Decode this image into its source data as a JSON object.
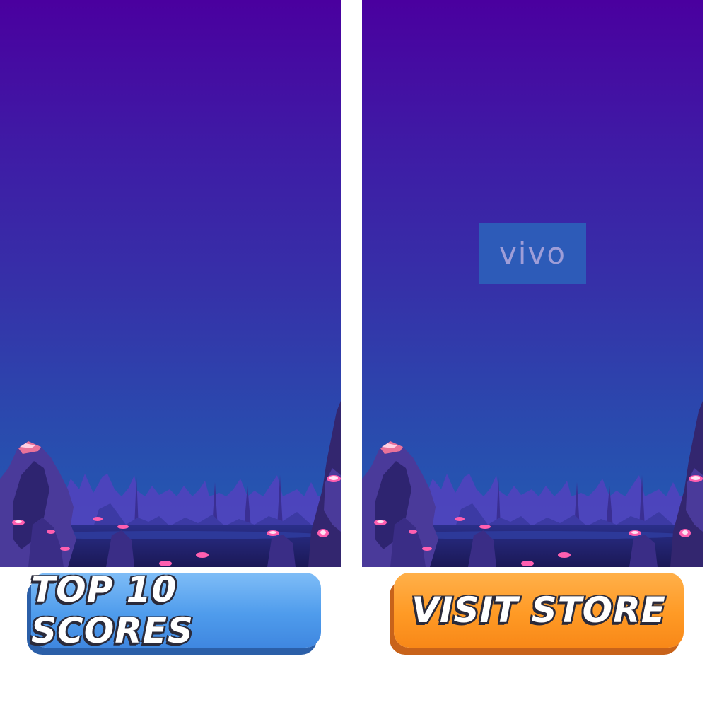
{
  "left_panel": {
    "background_top": "#4a009f",
    "background_bottom": "#2160b3"
  },
  "right_panel": {
    "logo_text": "vivo",
    "logo_box_color": "#2d5bb8",
    "logo_text_color": "#9e9dd8"
  },
  "buttons": {
    "top_scores_label": "TOP 10 SCORES",
    "visit_store_label": "VISIT STORE",
    "blue": "#4f9cec",
    "orange": "#ff9a25"
  }
}
